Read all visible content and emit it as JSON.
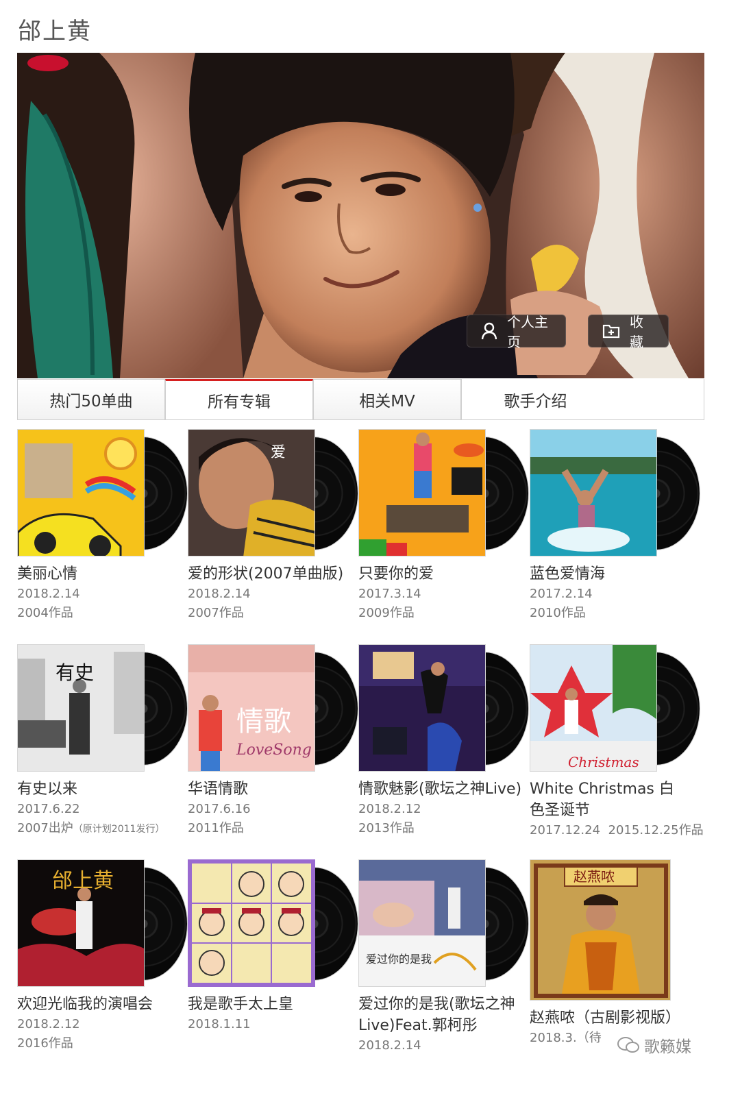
{
  "artist": {
    "name": "邰上黄"
  },
  "hero": {
    "profile_label": "个人主页",
    "favorite_label": "收藏",
    "icons": {
      "profile": "user-icon",
      "favorite": "folder-add-icon"
    }
  },
  "tabs": [
    {
      "label": "热门50单曲",
      "active": false
    },
    {
      "label": "所有专辑",
      "active": true
    },
    {
      "label": "相关MV",
      "active": false
    },
    {
      "label": "歌手介绍",
      "active": false
    }
  ],
  "albums": [
    {
      "title": "美丽心情",
      "date": "2018.2.14",
      "note": "2004作品"
    },
    {
      "title": "爱的形状(2007单曲版)",
      "date": "2018.2.14",
      "note": "2007作品"
    },
    {
      "title": "只要你的爱",
      "date": "2017.3.14",
      "note": "2009作品"
    },
    {
      "title": "蓝色爱情海",
      "date": "2017.2.14",
      "note": "2010作品"
    },
    {
      "title": "有史以来",
      "date": "2017.6.22",
      "note": "2007出炉",
      "note_small": "（原计划2011发行）"
    },
    {
      "title": "华语情歌",
      "date": "2017.6.16",
      "note": "2011作品"
    },
    {
      "title": "情歌魅影(歌坛之神Live)",
      "date": "2018.2.12",
      "note": "2013作品"
    },
    {
      "title": "White Christmas 白色圣诞节",
      "date": "2017.12.24",
      "note": "2015.12.25作品"
    },
    {
      "title": "欢迎光临我的演唱会",
      "date": "2018.2.12",
      "note": "2016作品"
    },
    {
      "title": "我是歌手太上皇",
      "date": "2018.1.11",
      "note": ""
    },
    {
      "title": "爱过你的是我(歌坛之神Live)Feat.郭柯彤",
      "date": "2018.2.14",
      "note": ""
    },
    {
      "title": "赵燕哝（古剧影视版）",
      "date": "2018.3.（待",
      "note": ""
    }
  ],
  "watermark": {
    "text": "歌籁媒"
  }
}
